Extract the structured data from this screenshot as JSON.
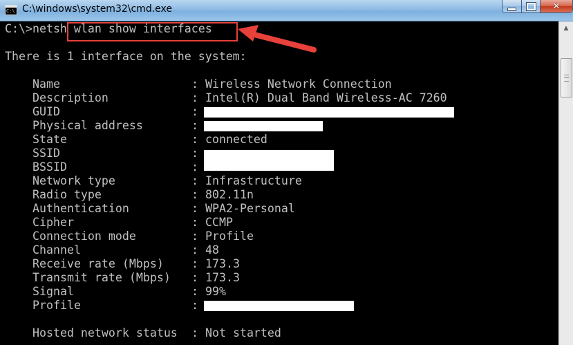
{
  "window": {
    "title": "C:\\windows\\system32\\cmd.exe",
    "icon_label": "C:\\"
  },
  "console": {
    "prompt": "C:\\>",
    "command_prefix": "netsh",
    "command_rest": " wlan show interfaces",
    "summary": "There is 1 interface on the system:",
    "properties": [
      {
        "name": "Name",
        "value": "Wireless Network Connection",
        "redacted": false
      },
      {
        "name": "Description",
        "value": "Intel(R) Dual Band Wireless-AC 7260",
        "redacted": false
      },
      {
        "name": "GUID",
        "value": "",
        "redacted": true
      },
      {
        "name": "Physical address",
        "value": "",
        "redacted": true
      },
      {
        "name": "State",
        "value": "connected",
        "redacted": false
      },
      {
        "name": "SSID",
        "value": "",
        "redacted": true
      },
      {
        "name": "BSSID",
        "value": "",
        "redacted": true
      },
      {
        "name": "Network type",
        "value": "Infrastructure",
        "redacted": false
      },
      {
        "name": "Radio type",
        "value": "802.11n",
        "redacted": false
      },
      {
        "name": "Authentication",
        "value": "WPA2-Personal",
        "redacted": false
      },
      {
        "name": "Cipher",
        "value": "CCMP",
        "redacted": false
      },
      {
        "name": "Connection mode",
        "value": "Profile",
        "redacted": false
      },
      {
        "name": "Channel",
        "value": "48",
        "redacted": false
      },
      {
        "name": "Receive rate (Mbps)",
        "value": "173.3",
        "redacted": false
      },
      {
        "name": "Transmit rate (Mbps)",
        "value": "173.3",
        "redacted": false
      },
      {
        "name": "Signal",
        "value": "99%",
        "redacted": false
      },
      {
        "name": "Profile",
        "value": "",
        "redacted": true
      }
    ],
    "hosted_network": {
      "name": "Hosted network status",
      "value": "Not started"
    },
    "separator": ":"
  },
  "colors": {
    "console_bg": "#000000",
    "console_text": "#c0c0c0",
    "annotation": "#e8403a",
    "redaction": "#ffffff"
  },
  "icons": [
    "cmd-app-icon",
    "minimize-icon",
    "maximize-icon",
    "close-icon",
    "scroll-up-arrow-icon",
    "scroll-grip-icon",
    "annotation-arrow-icon"
  ]
}
